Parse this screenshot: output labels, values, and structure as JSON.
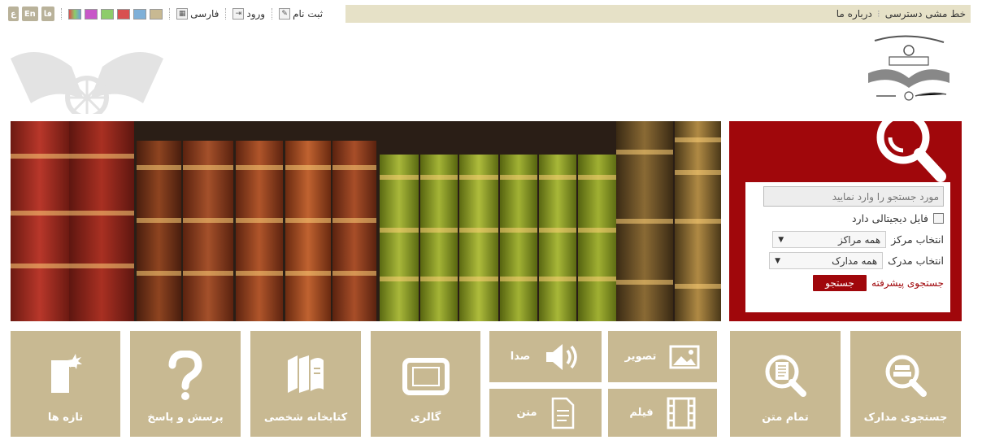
{
  "topbar": {
    "right_links": [
      "خط مشی دسترسی",
      "درباره ما"
    ],
    "lang_buttons": [
      "ع",
      "En",
      "فا"
    ],
    "swatches": [
      "#b9b29a",
      "#7fb0d8",
      "#d85050",
      "#c857c8",
      "#8dcc6a",
      "#c8b992",
      "#6aa0d8"
    ],
    "language_label": "فارسی",
    "login_label": "ورود",
    "register_label": "ثبت نام"
  },
  "search": {
    "placeholder": "مورد جستجو را وارد نمایید",
    "digital_label": "فایل دیجیتالی دارد",
    "center_label": "انتخاب مرکز",
    "center_value": "همه مراکز",
    "doc_label": "انتخاب مدرک",
    "doc_value": "همه مدارک",
    "advanced_label": "جستجوی پیشرفته",
    "button_label": "جستجو"
  },
  "tiles": {
    "documents": "جستجوی مدارک",
    "fulltext": "تمام متن",
    "image": "تصویر",
    "film": "فیلم",
    "audio": "صدا",
    "text": "متن",
    "gallery": "گالری",
    "library": "کتابخانه شخصی",
    "qa": "پرسش و پاسخ",
    "news": "تازه ها"
  },
  "colors": {
    "accent": "#a0070b",
    "tile": "#c8b992",
    "topbar": "#e6e1c7"
  }
}
